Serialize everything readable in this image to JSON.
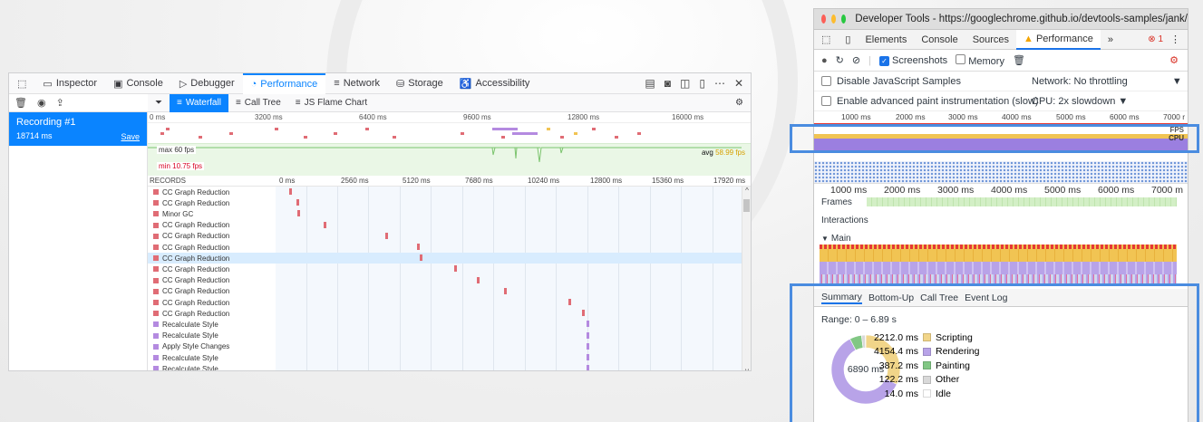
{
  "firefox": {
    "tabs": [
      "Inspector",
      "Console",
      "Debugger",
      "Performance",
      "Network",
      "Storage",
      "Accessibility"
    ],
    "recording": {
      "name": "Recording #1",
      "duration": "18714 ms",
      "save": "Save"
    },
    "subtabs": [
      "Waterfall",
      "Call Tree",
      "JS Flame Chart"
    ],
    "overview_ticks": [
      "0 ms",
      "3200 ms",
      "6400 ms",
      "9600 ms",
      "12800 ms",
      "16000 ms"
    ],
    "fps": {
      "max": "max 60 fps",
      "min": "min 10.75 fps",
      "avg_label": "avg",
      "avg_value": "58.99 fps"
    },
    "waterfall": {
      "header": "RECORDS",
      "ticks": [
        "0 ms",
        "2560 ms",
        "5120 ms",
        "7680 ms",
        "10240 ms",
        "12800 ms",
        "15360 ms",
        "17920 ms"
      ],
      "rows": [
        {
          "name": "CC Graph Reduction",
          "color": "#e06c75",
          "t": 0.03
        },
        {
          "name": "CC Graph Reduction",
          "color": "#e06c75",
          "t": 0.045
        },
        {
          "name": "Minor GC",
          "color": "#e06c75",
          "t": 0.048
        },
        {
          "name": "CC Graph Reduction",
          "color": "#e06c75",
          "t": 0.105
        },
        {
          "name": "CC Graph Reduction",
          "color": "#e06c75",
          "t": 0.24
        },
        {
          "name": "CC Graph Reduction",
          "color": "#e06c75",
          "t": 0.31
        },
        {
          "name": "CC Graph Reduction",
          "color": "#e06c75",
          "t": 0.315,
          "selected": true
        },
        {
          "name": "CC Graph Reduction",
          "color": "#e06c75",
          "t": 0.39
        },
        {
          "name": "CC Graph Reduction",
          "color": "#e06c75",
          "t": 0.44
        },
        {
          "name": "CC Graph Reduction",
          "color": "#e06c75",
          "t": 0.5
        },
        {
          "name": "CC Graph Reduction",
          "color": "#e06c75",
          "t": 0.64
        },
        {
          "name": "CC Graph Reduction",
          "color": "#e06c75",
          "t": 0.67
        },
        {
          "name": "Recalculate Style",
          "color": "#b48ae0",
          "t": 0.68
        },
        {
          "name": "Recalculate Style",
          "color": "#b48ae0",
          "t": 0.68
        },
        {
          "name": "Apply Style Changes",
          "color": "#b48ae0",
          "t": 0.68
        },
        {
          "name": "Recalculate Style",
          "color": "#b48ae0",
          "t": 0.68
        },
        {
          "name": "Recalculate Style",
          "color": "#b48ae0",
          "t": 0.68
        }
      ]
    }
  },
  "chrome": {
    "title": "Developer Tools - https://googlechrome.github.io/devtools-samples/jank/",
    "tabs": [
      "Elements",
      "Console",
      "Sources",
      "Performance"
    ],
    "warning_count": "1",
    "toolbar": {
      "screenshots": "Screenshots",
      "memory": "Memory"
    },
    "options": {
      "disable_js": "Disable JavaScript Samples",
      "network": "Network:",
      "network_value": "No throttling",
      "paint": "Enable advanced paint instrumentation (slow)",
      "cpu": "CPU:",
      "cpu_value": "2x slowdown"
    },
    "ruler_ticks": [
      "1000 ms",
      "2000 ms",
      "3000 ms",
      "4000 ms",
      "5000 ms",
      "6000 ms",
      "7000 r"
    ],
    "ruler2_ticks": [
      "1000 ms",
      "2000 ms",
      "3000 ms",
      "4000 ms",
      "5000 ms",
      "6000 ms",
      "7000 m"
    ],
    "track_labels": {
      "fps": "FPS",
      "cpu": "CPU",
      "frames": "Frames",
      "interactions": "Interactions",
      "main": "Main"
    },
    "summary_tabs": [
      "Summary",
      "Bottom-Up",
      "Call Tree",
      "Event Log"
    ],
    "range": "Range: 0 – 6.89 s",
    "donut_total": "6890 ms",
    "summary": [
      {
        "value": "2212.0 ms",
        "label": "Scripting",
        "color": "#f1d589",
        "ms": 2212.0
      },
      {
        "value": "4154.4 ms",
        "label": "Rendering",
        "color": "#b8a3e8",
        "ms": 4154.4
      },
      {
        "value": "387.2 ms",
        "label": "Painting",
        "color": "#81c784",
        "ms": 387.2
      },
      {
        "value": "122.2 ms",
        "label": "Other",
        "color": "#d9d9d9",
        "ms": 122.2
      },
      {
        "value": "14.0 ms",
        "label": "Idle",
        "color": "#ffffff",
        "ms": 14.0
      }
    ]
  }
}
